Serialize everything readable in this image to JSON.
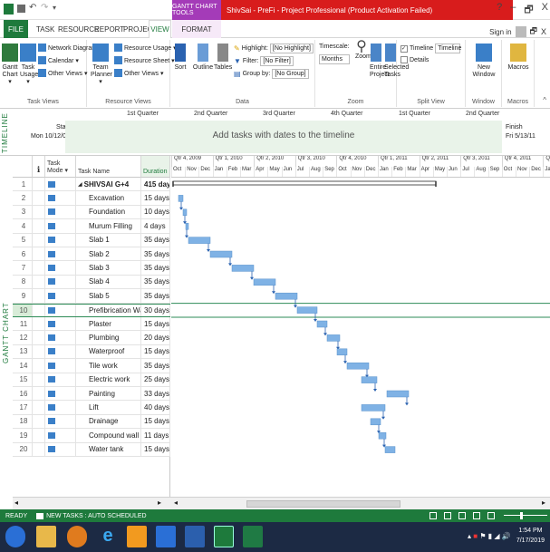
{
  "window": {
    "context_tab": "GANTT CHART TOOLS",
    "title": "ShivSai - PreFi - Project Professional (Product Activation Failed)",
    "help": "?",
    "minimize": "–",
    "restore": "🗗",
    "close": "X"
  },
  "tabs": {
    "file": "FILE",
    "task": "TASK",
    "resource": "RESOURCE",
    "report": "REPORT",
    "project": "PROJECT",
    "view": "VIEW",
    "format": "FORMAT",
    "signin": "Sign in"
  },
  "ribbon": {
    "task_views": {
      "gantt_chart": "Gantt Chart ▾",
      "task_usage": "Task Usage ▾",
      "network_diagram": "Network Diagram ▾",
      "calendar": "Calendar ▾",
      "other_views": "Other Views ▾",
      "label": "Task Views"
    },
    "resource_views": {
      "team_planner": "Team Planner ▾",
      "resource_usage": "Resource Usage ▾",
      "resource_sheet": "Resource Sheet ▾",
      "other_views": "Other Views ▾",
      "label": "Resource Views"
    },
    "data": {
      "sort": "Sort",
      "outline": "Outline",
      "tables": "Tables",
      "highlight_label": "Highlight:",
      "highlight_value": "[No Highlight]",
      "filter_label": "Filter:",
      "filter_value": "[No Filter]",
      "groupby_label": "Group by:",
      "groupby_value": "[No Group]",
      "label": "Data"
    },
    "zoom": {
      "timescale_label": "Timescale:",
      "timescale_value": "Months",
      "zoom": "Zoom",
      "entire_project": "Entire Project",
      "selected_tasks": "Selected Tasks",
      "label": "Zoom"
    },
    "split_view": {
      "timeline": "Timeline",
      "timeline_value": "Timeline",
      "details": "Details",
      "label": "Split View"
    },
    "window": {
      "new_window": "New Window",
      "label": "Window"
    },
    "macros": {
      "macros": "Macros",
      "label": "Macros"
    }
  },
  "timeline": {
    "side_label": "TIMELINE",
    "start_label": "Start",
    "start_date": "Mon 10/12/09",
    "finish_label": "Finish",
    "finish_date": "Fri 5/13/11",
    "quarters": [
      "1st Quarter",
      "2nd Quarter",
      "3rd Quarter",
      "4th Quarter",
      "1st Quarter",
      "2nd Quarter"
    ],
    "placeholder": "Add tasks with dates to the timeline"
  },
  "gantt": {
    "side_label": "GANTT CHART",
    "headers": {
      "info": "ℹ",
      "mode": "Task Mode ▾",
      "name": "Task Name",
      "duration": "Duration"
    },
    "quarters": [
      "Qtr 4, 2009",
      "Qtr 1, 2010",
      "Qtr 2, 2010",
      "Qtr 3, 2010",
      "Qtr 4, 2010",
      "Qtr 1, 2011",
      "Qtr 2, 2011",
      "Qtr 3, 2011",
      "Qtr 4, 2011",
      "Qtr"
    ],
    "months": [
      "Oct",
      "Nov",
      "Dec",
      "Jan",
      "Feb",
      "Mar",
      "Apr",
      "May",
      "Jun",
      "Jul",
      "Aug",
      "Sep",
      "Oct",
      "Nov",
      "Dec",
      "Jan",
      "Feb",
      "Mar",
      "Apr",
      "May",
      "Jun",
      "Jul",
      "Aug",
      "Sep",
      "Oct",
      "Nov",
      "Dec",
      "Ja"
    ],
    "tasks": [
      {
        "id": "1",
        "name": "SHIVSAI G+4",
        "duration": "415 days",
        "summary": true
      },
      {
        "id": "2",
        "name": "Excavation",
        "duration": "15 days"
      },
      {
        "id": "3",
        "name": "Foundation",
        "duration": "10 days"
      },
      {
        "id": "4",
        "name": "Murum Filling",
        "duration": "4 days"
      },
      {
        "id": "5",
        "name": "Slab 1",
        "duration": "35 days"
      },
      {
        "id": "6",
        "name": "Slab 2",
        "duration": "35 days"
      },
      {
        "id": "7",
        "name": "Slab 3",
        "duration": "35 days"
      },
      {
        "id": "8",
        "name": "Slab 4",
        "duration": "35 days"
      },
      {
        "id": "9",
        "name": "Slab 5",
        "duration": "35 days"
      },
      {
        "id": "10",
        "name": "Prefibrication Walls",
        "duration": "30 days"
      },
      {
        "id": "11",
        "name": "Plaster",
        "duration": "15 days"
      },
      {
        "id": "12",
        "name": "Plumbing",
        "duration": "20 days"
      },
      {
        "id": "13",
        "name": "Waterproof",
        "duration": "15 days"
      },
      {
        "id": "14",
        "name": "Tile work",
        "duration": "35 days"
      },
      {
        "id": "15",
        "name": "Electric work",
        "duration": "25 days"
      },
      {
        "id": "16",
        "name": "Painting",
        "duration": "33 days"
      },
      {
        "id": "17",
        "name": "Lift",
        "duration": "40 days"
      },
      {
        "id": "18",
        "name": "Drainage",
        "duration": "15 days"
      },
      {
        "id": "19",
        "name": "Compound wall",
        "duration": "11 days"
      },
      {
        "id": "20",
        "name": "Water tank",
        "duration": "15 days"
      }
    ],
    "selected_row": "10"
  },
  "status": {
    "ready": "READY",
    "new_tasks": "NEW TASKS : AUTO SCHEDULED"
  },
  "taskbar": {
    "time": "1:54 PM",
    "date": "7/17/2019"
  },
  "colors": {
    "accent": "#1e7a3c",
    "bar": "#7fb2e5",
    "title_red": "#d81c1c",
    "context": "#a43bb8"
  }
}
